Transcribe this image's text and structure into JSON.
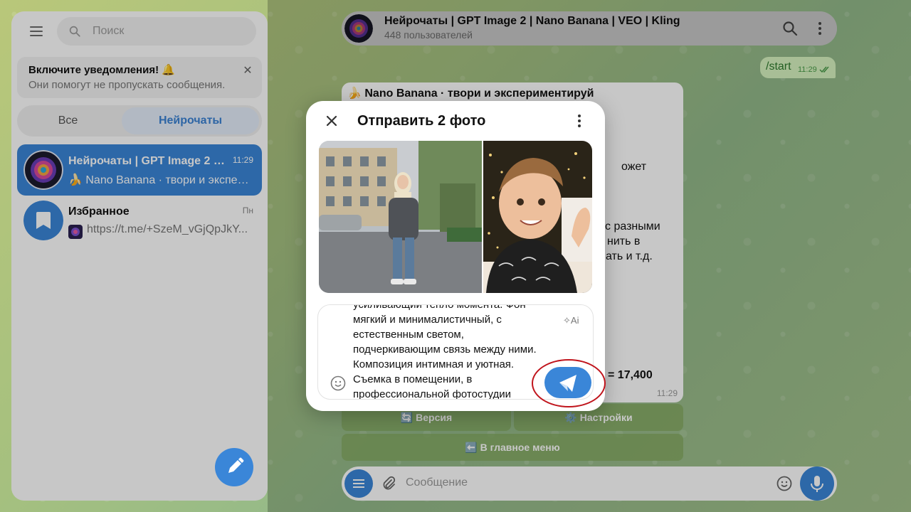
{
  "search": {
    "placeholder": "Поиск"
  },
  "notification": {
    "title": "Включите уведомления! 🔔",
    "subtitle": "Они помогут не пропускать сообщения."
  },
  "folders": {
    "all": "Все",
    "neuro": "Нейрочаты"
  },
  "chats": [
    {
      "name": "Нейрочаты | GPT Image 2 | Nano Banana | VEO | Kling",
      "preview": "🍌 Nano Banana · твори и экспериментируй",
      "time": "11:29",
      "active": true
    },
    {
      "name": "Избранное",
      "preview": "https://t.me/+SzeM_vGjQpJkY...",
      "time": "Пн",
      "active": false
    }
  ],
  "header": {
    "title": "Нейрочаты | GPT Image 2 | Nano Banana | VEO | Kling",
    "subtitle": "448 пользователей"
  },
  "messages": {
    "start": {
      "text": "/start",
      "time": "11:29"
    },
    "bot": {
      "title": "🍌 Nano Banana · твори и экспериментируй",
      "frag1": "ожет",
      "frag2": "с разными",
      "frag3": "нить в",
      "frag4": "ать и т.д.",
      "frag5": "= 17,400",
      "time": "11:29"
    }
  },
  "keyboard": {
    "version": "🔄 Версия",
    "settings": "⚙️ Настройки",
    "main_menu": "⬅️ В главное меню"
  },
  "composer": {
    "placeholder": "Сообщение"
  },
  "modal": {
    "title": "Отправить 2 фото",
    "caption_text": "усиливающий тепло момента. Фон мягкий и минималистичный, с естественным светом, подчеркивающим связь между ними. Композиция интимная и уютная. Съемка в помещении, в профессиональной фотостудии",
    "ai_label": "Ai"
  },
  "colors": {
    "accent": "#3a86d8",
    "highlight_ring": "#c0141c",
    "outgoing_bubble": "#d8f4c0"
  }
}
